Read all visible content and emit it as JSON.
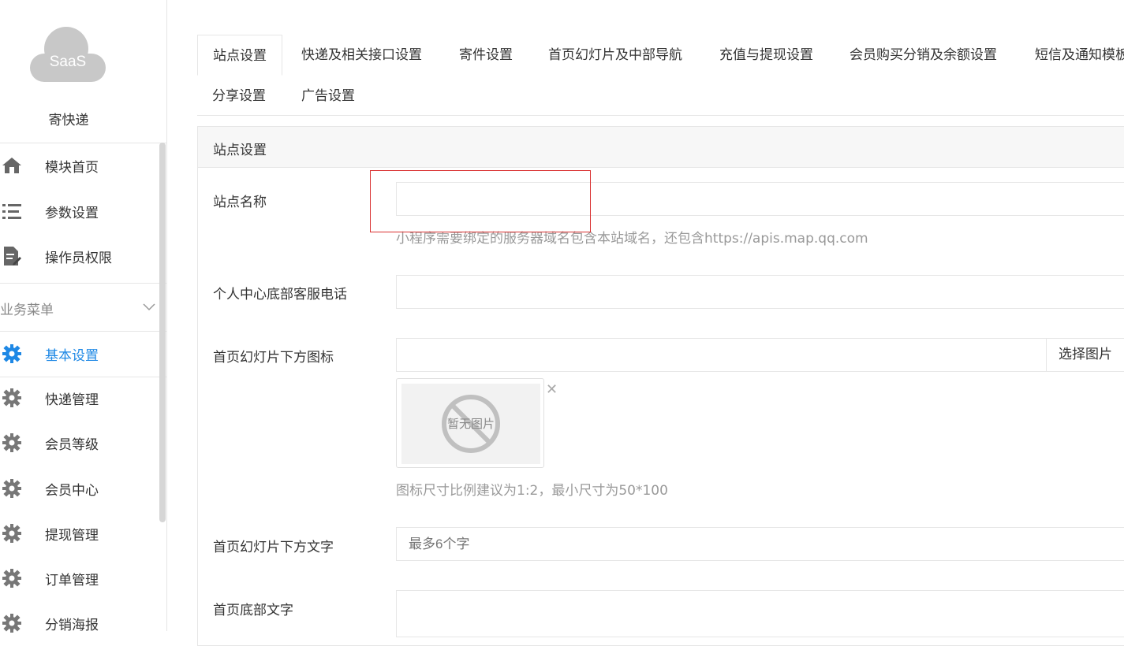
{
  "sidebar": {
    "logo_text": "SaaS",
    "site_name": "寄快递",
    "top_items": [
      {
        "label": "模块首页",
        "icon": "home-icon"
      },
      {
        "label": "参数设置",
        "icon": "list-icon"
      },
      {
        "label": "操作员权限",
        "icon": "document-edit-icon"
      }
    ],
    "group_label": "业务菜单",
    "group_items": [
      {
        "label": "基本设置",
        "icon": "gear-icon",
        "active": true
      },
      {
        "label": "快递管理",
        "icon": "gear-icon"
      },
      {
        "label": "会员等级",
        "icon": "gear-icon"
      },
      {
        "label": "会员中心",
        "icon": "gear-icon"
      },
      {
        "label": "提现管理",
        "icon": "gear-icon"
      },
      {
        "label": "订单管理",
        "icon": "gear-icon"
      },
      {
        "label": "分销海报",
        "icon": "gear-icon"
      }
    ]
  },
  "tabs": [
    "站点设置",
    "快递及相关接口设置",
    "寄件设置",
    "首页幻灯片及中部导航",
    "充值与提现设置",
    "会员购买分销及余额设置",
    "短信及通知模板",
    "分享设置",
    "广告设置"
  ],
  "panel": {
    "title": "站点设置",
    "fields": {
      "site_name": {
        "label": "站点名称",
        "value": "",
        "help": "小程序需要绑定的服务器域名包含本站域名，还包含https://apis.map.qq.com"
      },
      "service_phone": {
        "label": "个人中心底部客服电话",
        "value": ""
      },
      "slide_icon": {
        "label": "首页幻灯片下方图标",
        "value": "",
        "button": "选择图片",
        "placeholder_image_text": "暂无图片",
        "help": "图标尺寸比例建议为1:2，最小尺寸为50*100"
      },
      "slide_text": {
        "label": "首页幻灯片下方文字",
        "placeholder": "最多6个字"
      },
      "footer_text": {
        "label": "首页底部文字",
        "value": ""
      }
    }
  },
  "colors": {
    "accent": "#1e88e5",
    "highlight_box": "#d93030"
  }
}
